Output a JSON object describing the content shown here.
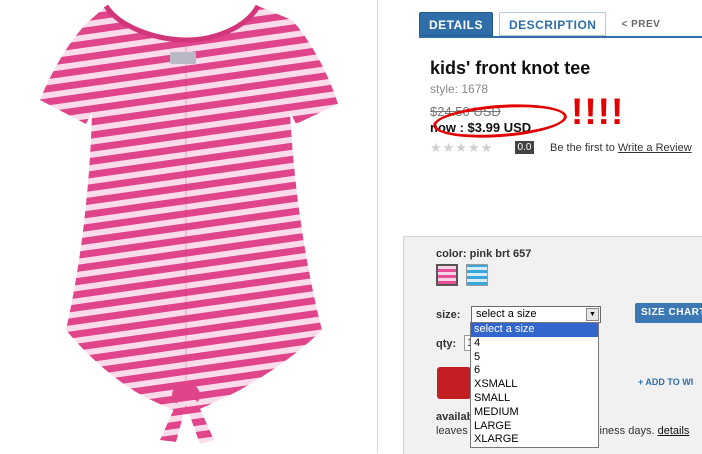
{
  "tabs": {
    "details": "DETAILS",
    "description": "DESCRIPTION",
    "prev": "PREV"
  },
  "product": {
    "title": "kids' front knot tee",
    "style": "style: 1678",
    "was_price": "$24.50 USD",
    "now_price": "now : $3.99 USD",
    "annotation": "!!!!"
  },
  "rating": {
    "value": "0.0",
    "text": "Be the first to",
    "link": "Write a Review"
  },
  "options": {
    "color_label": "color: pink brt 657",
    "swatches": [
      "pink-stripe",
      "blue-stripe"
    ],
    "size_label": "size:",
    "size_selected": "select a size",
    "size_chart": "SIZE CHART",
    "qty_label": "qty:",
    "qty_value": "1",
    "wishlist": "+ ADD TO WI",
    "avail": "availab",
    "leaves": "leaves",
    "days": "siness days.",
    "details_link": "details"
  },
  "size_options": [
    "select a size",
    "4",
    "5",
    "6",
    "XSMALL",
    "SMALL",
    "MEDIUM",
    "LARGE",
    "XLARGE"
  ],
  "colors": {
    "accent_blue": "#2f6ea8",
    "annotation_red": "#e30000",
    "tee_pink": "#e0448b",
    "tee_light": "#f9dbe9"
  }
}
